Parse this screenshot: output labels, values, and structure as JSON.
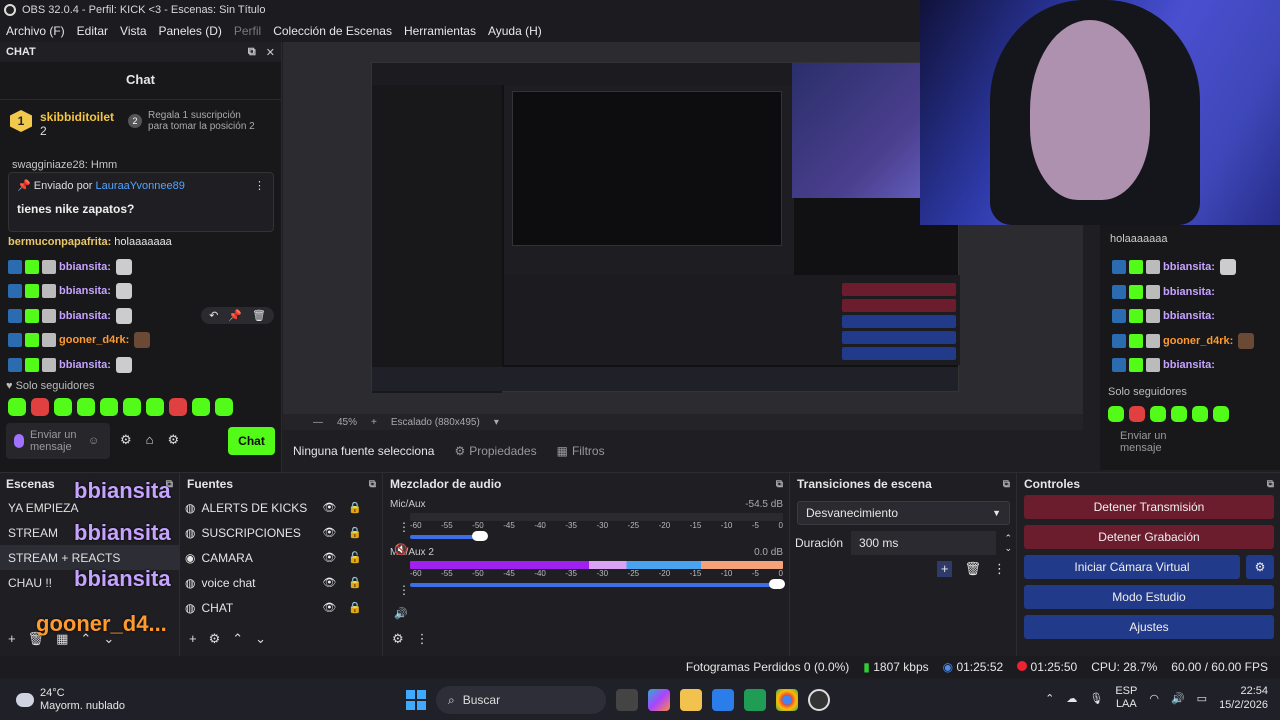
{
  "window": {
    "title": "OBS 32.0.4 - Perfil: KICK <3 - Escenas: Sin Título"
  },
  "menu": [
    "Archivo (F)",
    "Editar",
    "Vista",
    "Paneles (D)",
    "Perfil",
    "Colección de Escenas",
    "Herramientas",
    "Ayuda (H)"
  ],
  "chat_dock": {
    "dock_title": "CHAT",
    "title": "Chat",
    "leader": {
      "rank": "1",
      "user": "skibbiditoilet",
      "count": "2",
      "gift_rank": "2",
      "gift_text": "Regala 1 suscripción para tomar la posición 2"
    },
    "scroll_peek": "swagginiaze28: Hmm",
    "pinned": {
      "by_label": "Enviado por",
      "by_user": "LauraaYvonnee89",
      "message": "tienes nike zapatos?"
    },
    "lines": [
      {
        "user": "bermuconpapafrita:",
        "text": "holaaaaaaa",
        "style": "y"
      },
      {
        "user": "bbiansita:",
        "text": "",
        "style": "p"
      },
      {
        "user": "bbiansita:",
        "text": "",
        "style": "p"
      },
      {
        "user": "bbiansita:",
        "text": "",
        "style": "p"
      },
      {
        "user": "gooner_d4rk:",
        "text": "",
        "style": "o"
      },
      {
        "user": "bbiansita:",
        "text": "",
        "style": "p"
      }
    ],
    "followers_label": "Solo seguidores",
    "input_placeholder": "Enviar un mensaje",
    "send_label": "Chat"
  },
  "preview": {
    "zoom": "45%",
    "scale_label": "Escalado (880x495)",
    "no_source": "Ninguna fuente selecciona",
    "properties": "Propiedades",
    "filters": "Filtros"
  },
  "right_chat": {
    "lines": [
      "holaaaaaaa",
      "bbiansita:",
      "bbiansita:",
      "bbiansita:",
      "gooner_d4rk:",
      "bbiansita:"
    ],
    "followers_label": "Solo seguidores",
    "input_placeholder": "Enviar un mensaje"
  },
  "scenes": {
    "title": "Escenas",
    "items": [
      "YA EMPIEZA",
      "STREAM",
      "STREAM + REACTS",
      "CHAU !!"
    ],
    "selected": 2
  },
  "sources": {
    "title": "Fuentes",
    "items": [
      "ALERTS DE KICKS",
      "SUSCRIPCIONES",
      "CAMARA",
      "voice chat",
      "CHAT"
    ]
  },
  "mixer": {
    "title": "Mezclador de audio",
    "channels": [
      {
        "name": "Mic/Aux",
        "db": "-54.5 dB",
        "level": 0.02,
        "muted": true,
        "fader": 0.12
      },
      {
        "name": "Mic/Aux 2",
        "db": "0.0 dB",
        "level": 1.0,
        "muted": false,
        "fader": 1.0
      }
    ],
    "scale": [
      "-60",
      "-55",
      "-50",
      "-45",
      "-40",
      "-35",
      "-30",
      "-25",
      "-20",
      "-15",
      "-10",
      "-5",
      "0"
    ]
  },
  "transitions": {
    "title": "Transiciones de escena",
    "selected": "Desvanecimiento",
    "duration_label": "Duración",
    "duration": "300 ms"
  },
  "controls": {
    "title": "Controles",
    "buttons": [
      "Detener Transmisión",
      "Detener Grabación",
      "Iniciar Cámara Virtual",
      "Modo Estudio",
      "Ajustes"
    ]
  },
  "status": {
    "dropped": "Fotogramas Perdidos 0 (0.0%)",
    "bitrate": "1807 kbps",
    "stream_time": "01:25:52",
    "rec_time": "01:25:50",
    "cpu": "CPU: 28.7%",
    "fps": "60.00 / 60.00 FPS"
  },
  "taskbar": {
    "temp": "24°C",
    "weather": "Mayorm. nublado",
    "search": "Buscar",
    "lang1": "ESP",
    "lang2": "LAA",
    "time": "22:54",
    "date": "15/2/2026"
  },
  "overlay": {
    "names": [
      "bbiansita",
      "bbiansita",
      "bbiansita",
      "gooner_d4...",
      "bbiansita"
    ]
  },
  "colors": {
    "kick_green": "#53fc18",
    "stop_red": "#6b1d2e",
    "control_blue": "#223a8a",
    "username_purple": "#c5a3ff",
    "username_orange": "#ff9a2e"
  }
}
